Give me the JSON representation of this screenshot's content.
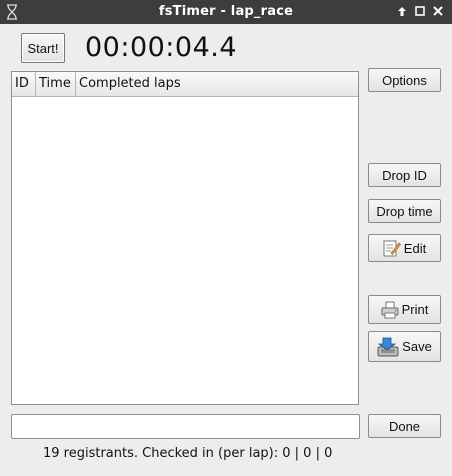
{
  "window": {
    "title": "fsTimer - lap_race",
    "controls": [
      "maximize-arrow",
      "restore",
      "close"
    ]
  },
  "timer": {
    "start_label": "Start!",
    "display": "00:00:04.4"
  },
  "table": {
    "columns": [
      "ID",
      "Time",
      "Completed laps"
    ],
    "rows": []
  },
  "side_buttons": {
    "options": "Options",
    "drop_id": "Drop ID",
    "drop_time": "Drop time",
    "edit": "Edit",
    "print": "Print",
    "save": "Save"
  },
  "entry": {
    "value": "",
    "done_label": "Done"
  },
  "status": "19 registrants. Checked in (per lap): 0 | 0 | 0",
  "colors": {
    "titlebar": "#3d3d3d",
    "window_bg": "#ededed",
    "list_bg": "#ffffff"
  }
}
